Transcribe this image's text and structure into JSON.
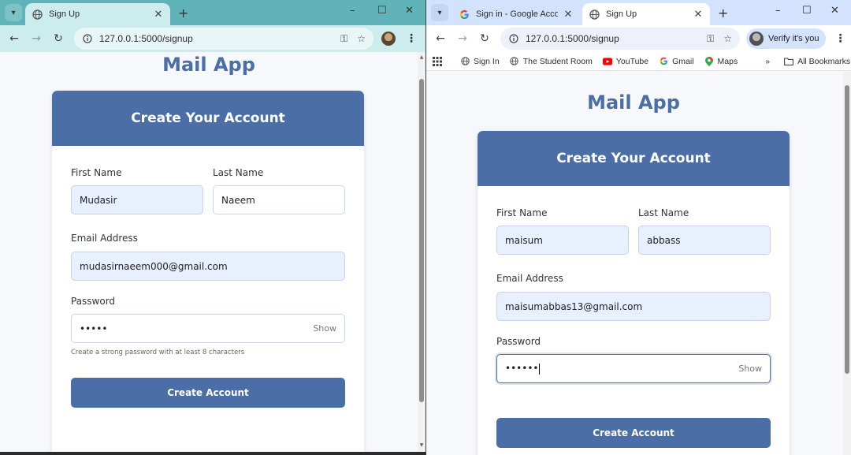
{
  "left_window": {
    "tab": {
      "title": "Sign Up",
      "favicon": "globe-icon"
    },
    "address": {
      "url": "127.0.0.1:5000/signup"
    },
    "page": {
      "app_title": "Mail App",
      "card_title": "Create Your Account",
      "first_name": {
        "label": "First Name",
        "value": "Mudasir"
      },
      "last_name": {
        "label": "Last Name",
        "value": "Naeem"
      },
      "email": {
        "label": "Email Address",
        "value": "mudasirnaeem000@gmail.com"
      },
      "password": {
        "label": "Password",
        "value": "•••••",
        "toggle": "Show",
        "hint": "Create a strong password with at least 8 characters"
      },
      "submit_label": "Create Account"
    }
  },
  "right_window": {
    "tabs": [
      {
        "title": "Sign in - Google Accounts",
        "favicon": "google-g-icon",
        "active": false
      },
      {
        "title": "Sign Up",
        "favicon": "globe-icon",
        "active": true
      }
    ],
    "address": {
      "url": "127.0.0.1:5000/signup"
    },
    "verify_label": "Verify it's you",
    "bookmarks": [
      {
        "label": "Sign In",
        "icon": "globe-icon"
      },
      {
        "label": "The Student Room",
        "icon": "globe-icon"
      },
      {
        "label": "YouTube",
        "icon": "youtube-icon"
      },
      {
        "label": "Gmail",
        "icon": "google-g-icon"
      },
      {
        "label": "Maps",
        "icon": "maps-pin-icon"
      }
    ],
    "all_bookmarks_label": "All Bookmarks",
    "page": {
      "app_title": "Mail App",
      "card_title": "Create Your Account",
      "first_name": {
        "label": "First Name",
        "value": "maisum"
      },
      "last_name": {
        "label": "Last Name",
        "value": "abbass"
      },
      "email": {
        "label": "Email Address",
        "value": "maisumabbas13@gmail.com"
      },
      "password": {
        "label": "Password",
        "value": "••••••",
        "toggle": "Show"
      },
      "submit_label": "Create Account"
    }
  },
  "colors": {
    "accent": "#4a6ea5",
    "left_chrome": "#5fb3b9",
    "right_chrome": "#d3e3fd",
    "filled_input": "#e8effd"
  }
}
